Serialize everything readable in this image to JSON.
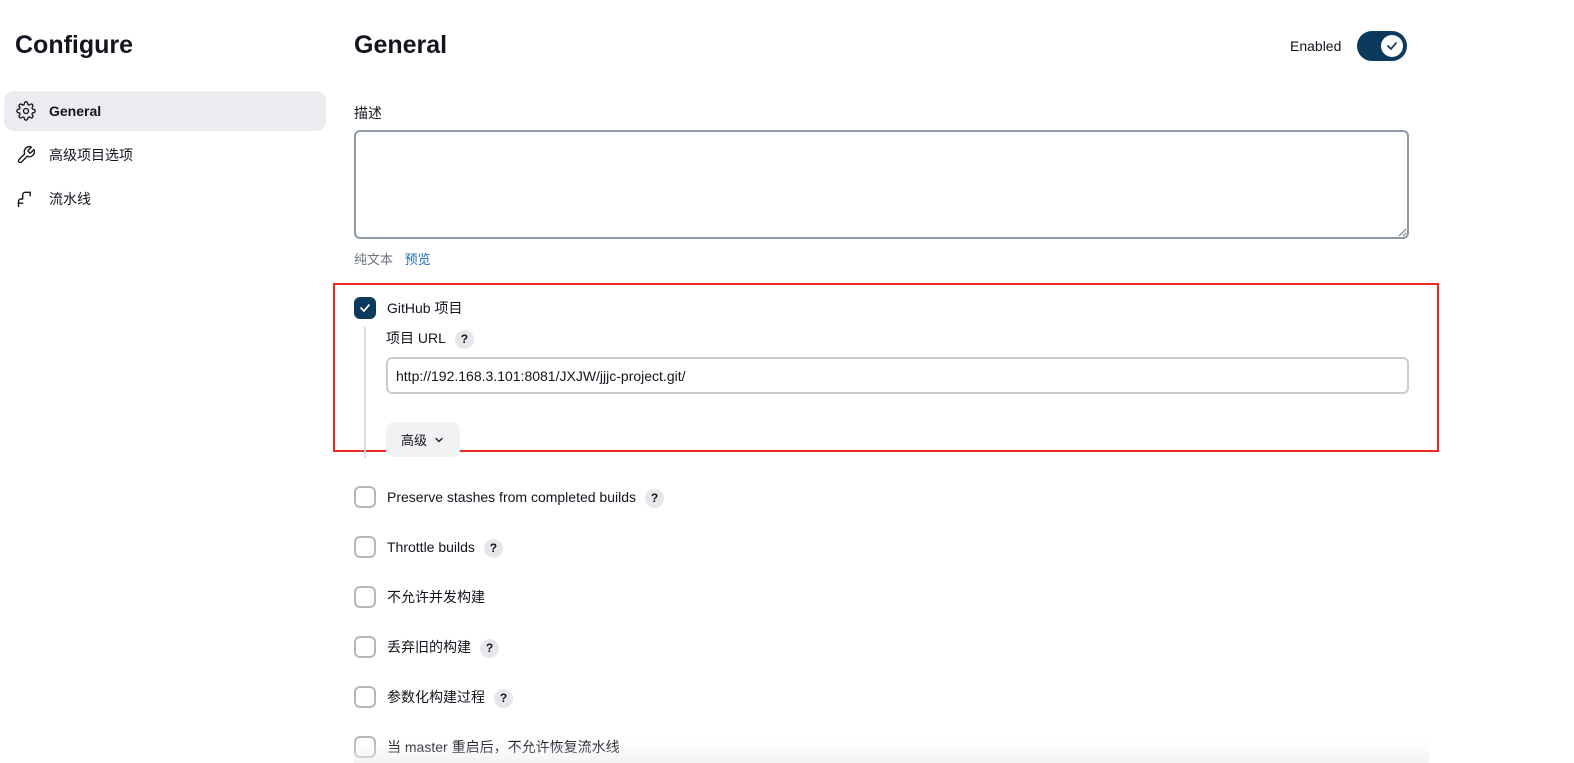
{
  "sidebar": {
    "title": "Configure",
    "items": [
      {
        "label": "General",
        "icon": "gear-icon",
        "active": true
      },
      {
        "label": "高级项目选项",
        "icon": "wrench-icon",
        "active": false
      },
      {
        "label": "流水线",
        "icon": "pipeline-icon",
        "active": false
      }
    ]
  },
  "main": {
    "title": "General",
    "enabled_label": "Enabled",
    "enabled": true,
    "description": {
      "label": "描述",
      "value": "",
      "plain_text_label": "纯文本",
      "preview_label": "预览"
    },
    "github_project": {
      "label": "GitHub 项目",
      "checked": true,
      "url_label": "项目 URL",
      "url_value": "http://192.168.3.101:8081/JXJW/jjjc-project.git/",
      "advanced_label": "高级"
    },
    "options": [
      {
        "label": "Preserve stashes from completed builds",
        "checked": false,
        "help": true
      },
      {
        "label": "Throttle builds",
        "checked": false,
        "help": true
      },
      {
        "label": "不允许并发构建",
        "checked": false,
        "help": false
      },
      {
        "label": "丢弃旧的构建",
        "checked": false,
        "help": true
      },
      {
        "label": "参数化构建过程",
        "checked": false,
        "help": true
      },
      {
        "label": "当 master 重启后，不允许恢复流水线",
        "checked": false,
        "help": false
      }
    ],
    "help_glyph": "?"
  },
  "colors": {
    "accent": "#0b3a5c",
    "highlight_border": "#ee2b22",
    "link": "#1f6fbf"
  }
}
